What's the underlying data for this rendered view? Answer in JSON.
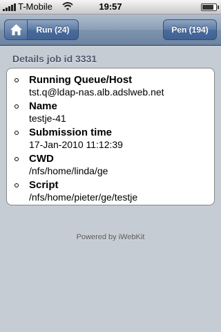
{
  "statusbar": {
    "carrier": "T-Mobile",
    "time": "19:57",
    "signal_icon": "signal-bars-icon",
    "wifi_icon": "wifi-icon",
    "battery_icon": "battery-icon",
    "battery_level": 0.85
  },
  "navbar": {
    "home_icon": "home-icon",
    "run_label": "Run (24)",
    "pen_label": "Pen (194)"
  },
  "details": {
    "title": "Details job id 3331",
    "items": [
      {
        "label": "Running Queue/Host",
        "value": "tst.q@ldap-nas.alb.adslweb.net"
      },
      {
        "label": "Name",
        "value": "testje-41"
      },
      {
        "label": "Submission time",
        "value": "17-Jan-2010 11:12:39"
      },
      {
        "label": "CWD",
        "value": "/nfs/home/linda/ge"
      },
      {
        "label": "Script",
        "value": "/nfs/home/pieter/ge/testje"
      }
    ]
  },
  "footer": {
    "text": "Powered by iWebKit"
  },
  "colors": {
    "background": "#c5ccd4",
    "navbar": "#6d84a2",
    "button": "#4a6c9b",
    "title_text": "#4c566c"
  }
}
